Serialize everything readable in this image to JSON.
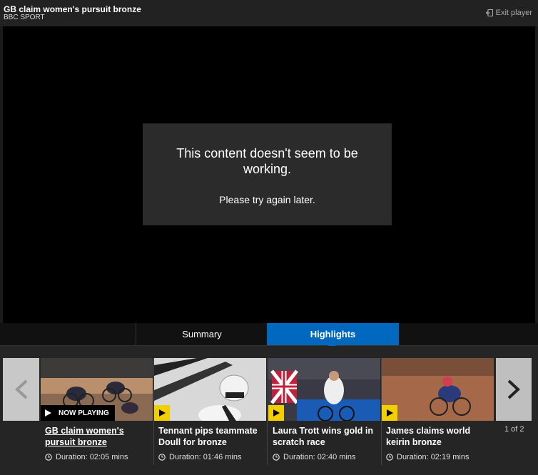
{
  "header": {
    "title": "GB claim women's pursuit bronze",
    "subtitle": "BBC SPORT",
    "exit_label": "Exit player"
  },
  "player": {
    "error_message": "This content doesn't seem to be working.",
    "error_sub": "Please try again later."
  },
  "tabs": [
    {
      "label": "Summary",
      "active": false
    },
    {
      "label": "Highlights",
      "active": true
    }
  ],
  "carousel": {
    "page_indicator": "1 of 2",
    "now_playing_label": "NOW PLAYING",
    "items": [
      {
        "title": "GB claim women's pursuit bronze",
        "duration": "Duration: 02:05 mins",
        "current": true
      },
      {
        "title": "Tennant pips teammate Doull for bronze",
        "duration": "Duration: 01:46 mins",
        "current": false
      },
      {
        "title": "Laura Trott wins gold in scratch race",
        "duration": "Duration: 02:40 mins",
        "current": false
      },
      {
        "title": "James claims world keirin bronze",
        "duration": "Duration: 02:19 mins",
        "current": false
      }
    ]
  },
  "colors": {
    "accent": "#0068bf",
    "play_badge": "#f2cf00",
    "background": "#1b1b1b"
  },
  "icons": {
    "exit": "exit-icon",
    "prev": "chevron-left-icon",
    "next": "chevron-right-icon",
    "play": "play-icon",
    "clock": "clock-icon"
  }
}
